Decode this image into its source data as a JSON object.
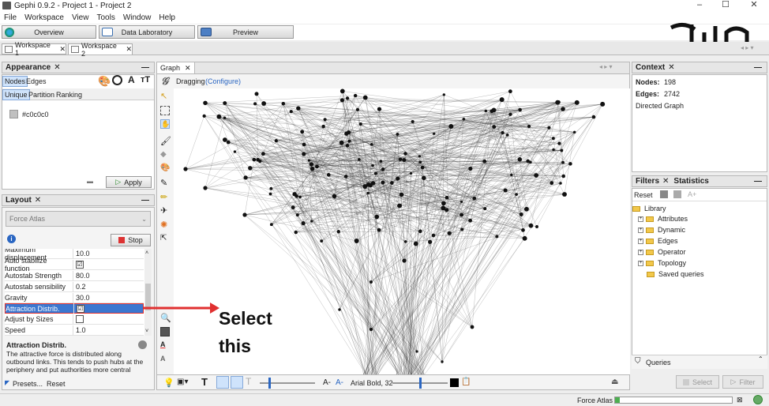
{
  "window": {
    "title": "Gephi 0.9.2 - Project 1 - Project 2",
    "min": "–",
    "max": "☐",
    "close": "✕"
  },
  "menu": [
    "File",
    "Workspace",
    "View",
    "Tools",
    "Window",
    "Help"
  ],
  "modes": {
    "overview": "Overview",
    "data_lab": "Data Laboratory",
    "preview": "Preview"
  },
  "workspaces": {
    "tab1": "Workspace 1",
    "tab2": "Workspace 2",
    "close": "✕"
  },
  "appearance": {
    "title": "Appearance",
    "close": "✕",
    "min": "—",
    "tab_nodes": "Nodes",
    "tab_edges": "Edges",
    "sub_unique": "Unique",
    "sub_partition": "Partition",
    "sub_ranking": "Ranking",
    "color_value": "#c0c0c0",
    "apply": "Apply"
  },
  "layout": {
    "title": "Layout",
    "close": "✕",
    "min": "—",
    "algorithm": "Force Atlas",
    "stop": "Stop",
    "props": [
      {
        "label": "Maximum displacement",
        "value": "10.0"
      },
      {
        "label": "Auto stabilize function",
        "value": "☑"
      },
      {
        "label": "Autostab Strength",
        "value": "80.0"
      },
      {
        "label": "Autostab sensibility",
        "value": "0.2"
      },
      {
        "label": "Gravity",
        "value": "30.0"
      },
      {
        "label": "Attraction Distrib.",
        "value": "☑"
      },
      {
        "label": "Adjust by Sizes",
        "value": ""
      },
      {
        "label": "Speed",
        "value": "1.0"
      }
    ],
    "desc_title": "Attraction Distrib.",
    "desc_text": "The attractive force is distributed along outbound links. This tends to push hubs at the periphery and put authorities more central",
    "presets": "Presets...",
    "reset": "Reset"
  },
  "graph": {
    "title": "Graph",
    "close": "✕",
    "dragging": "Dragging",
    "configure": "(Configure)",
    "font_label": "Arial Bold, 32"
  },
  "annotation": {
    "line1": "Select",
    "line2": "this"
  },
  "context": {
    "title": "Context",
    "close": "✕",
    "min": "—",
    "nodes_label": "Nodes:",
    "nodes_value": "198",
    "edges_label": "Edges:",
    "edges_value": "2742",
    "graph_type": "Directed Graph"
  },
  "filters": {
    "tab_filters": "Filters",
    "tab_statistics": "Statistics",
    "close": "✕",
    "min": "—",
    "reset": "Reset",
    "library": "Library",
    "items": [
      "Attributes",
      "Dynamic",
      "Edges",
      "Operator",
      "Topology"
    ],
    "saved": "Saved queries",
    "queries": "Queries",
    "select": "Select",
    "filter": "Filter"
  },
  "status": {
    "layout_name": "Force Atlas"
  },
  "colors": {
    "accent_blue": "#3b77d0",
    "highlight_red": "#e03030"
  }
}
